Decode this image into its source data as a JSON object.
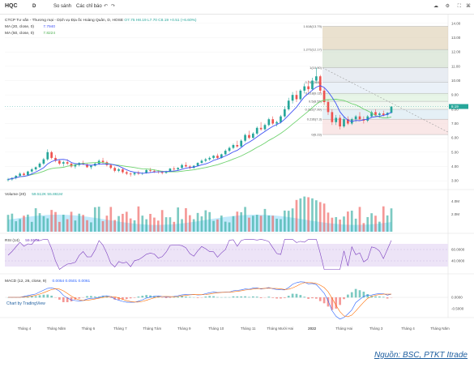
{
  "toolbar": {
    "symbol": "HQC",
    "interval": "D",
    "compare": "So sánh",
    "indicators": "Các chỉ báo",
    "undo": "↶",
    "redo": "↷"
  },
  "legend": {
    "main": "CTCP Tư vấn - Thương mại - Dịch vụ Địa ốc Hoàng Quân, D, HOSE",
    "ohlc": "O7.75  H8.19  L7.70  C8.19  +0.51 (+6.60%)",
    "ma20_label": "MA (20, close, 0)",
    "ma20_value": "7.7940",
    "ma50_label": "MA (50, close, 0)",
    "ma50_value": "7.8224",
    "volume_label": "Volume (20)",
    "volume_values": "59.512K  55.861M",
    "rsi_label": "RSI (14)",
    "rsi_value": "59.5503",
    "macd_label": "MACD (12, 26, close, 9)",
    "macd_values": "0.0054  0.0501  0.0061"
  },
  "badge": "Chart by TradingView",
  "source": "Nguồn: BSC, PTKT Itrade",
  "colors": {
    "up": "#26a69a",
    "down": "#ef5350",
    "ma20": "#3f51f5",
    "ma50": "#6fd26f",
    "rsi": "#7b3fbf",
    "macd": "#2962ff",
    "signal": "#ff6d00"
  },
  "chart_data": {
    "type": "candlestick",
    "x_labels": [
      "Tháng 4",
      "Tháng Năm",
      "Tháng 6",
      "Tháng 7",
      "Tháng Tám",
      "Tháng 9",
      "Tháng 10",
      "Tháng 11",
      "Tháng Mười Hai",
      "2022",
      "Tháng Hai",
      "Tháng 3",
      "Tháng 4",
      "Tháng Năm"
    ],
    "y_ticks": [
      3.0,
      4.0,
      5.0,
      6.0,
      7.0,
      8.0,
      9.0,
      10.0,
      11.0,
      12.0,
      13.0,
      14.0
    ],
    "price_range": [
      2.5,
      14.5
    ],
    "last_price": 8.19,
    "fibonacci": [
      {
        "label": "1.618(13.79)",
        "value": 13.79
      },
      {
        "label": "1.272(12.17)",
        "value": 12.17
      },
      {
        "label": "1(10.90)",
        "value": 10.9
      },
      {
        "label": "0.786(9.88)",
        "value": 9.88
      },
      {
        "label": "0.618(9.11)",
        "value": 9.11
      },
      {
        "label": "0.5(8.55)",
        "value": 8.55
      },
      {
        "label": "0.382(7.99)",
        "value": 7.99
      },
      {
        "label": "0.236(7.3)",
        "value": 7.3
      },
      {
        "label": "0(6.23)",
        "value": 6.23
      }
    ],
    "candles": [
      [
        3.05,
        3.2,
        2.95,
        3.1
      ],
      [
        3.1,
        3.25,
        3.0,
        3.2
      ],
      [
        3.2,
        3.4,
        3.1,
        3.35
      ],
      [
        3.35,
        3.6,
        3.25,
        3.5
      ],
      [
        3.5,
        3.6,
        3.3,
        3.4
      ],
      [
        3.4,
        3.7,
        3.35,
        3.65
      ],
      [
        3.65,
        3.9,
        3.55,
        3.8
      ],
      [
        3.8,
        4.0,
        3.7,
        3.95
      ],
      [
        3.95,
        4.3,
        3.9,
        4.2
      ],
      [
        4.2,
        4.6,
        4.1,
        4.5
      ],
      [
        4.5,
        5.2,
        4.4,
        5.0
      ],
      [
        5.0,
        5.1,
        4.5,
        4.6
      ],
      [
        4.6,
        4.8,
        4.3,
        4.4
      ],
      [
        4.4,
        4.5,
        4.1,
        4.2
      ],
      [
        4.2,
        4.4,
        4.0,
        4.3
      ],
      [
        4.3,
        4.5,
        4.1,
        4.2
      ],
      [
        4.2,
        4.3,
        3.9,
        4.0
      ],
      [
        4.0,
        4.2,
        3.85,
        4.1
      ],
      [
        4.1,
        4.3,
        4.0,
        4.25
      ],
      [
        4.25,
        4.4,
        4.1,
        4.15
      ],
      [
        4.15,
        4.2,
        3.9,
        3.95
      ],
      [
        3.95,
        4.1,
        3.8,
        4.05
      ],
      [
        4.05,
        4.3,
        4.0,
        4.2
      ],
      [
        4.2,
        4.5,
        4.1,
        4.4
      ],
      [
        4.4,
        4.6,
        4.2,
        4.3
      ],
      [
        4.3,
        4.4,
        4.0,
        4.1
      ],
      [
        4.1,
        4.2,
        3.8,
        3.9
      ],
      [
        3.9,
        4.0,
        3.6,
        3.7
      ],
      [
        3.7,
        3.9,
        3.6,
        3.8
      ],
      [
        3.8,
        3.9,
        3.5,
        3.6
      ],
      [
        3.6,
        3.7,
        3.4,
        3.5
      ],
      [
        3.5,
        3.6,
        3.3,
        3.45
      ],
      [
        3.45,
        3.6,
        3.35,
        3.55
      ],
      [
        3.55,
        3.7,
        3.4,
        3.5
      ],
      [
        3.5,
        3.6,
        3.4,
        3.55
      ],
      [
        3.55,
        3.8,
        3.5,
        3.75
      ],
      [
        3.75,
        3.9,
        3.6,
        3.7
      ],
      [
        3.7,
        3.8,
        3.55,
        3.65
      ],
      [
        3.65,
        3.75,
        3.5,
        3.6
      ],
      [
        3.6,
        3.7,
        3.45,
        3.55
      ],
      [
        3.55,
        3.7,
        3.5,
        3.65
      ],
      [
        3.65,
        3.9,
        3.6,
        3.85
      ],
      [
        3.85,
        4.0,
        3.7,
        3.8
      ],
      [
        3.8,
        3.95,
        3.7,
        3.9
      ],
      [
        3.9,
        4.2,
        3.85,
        4.1
      ],
      [
        4.1,
        4.3,
        3.95,
        4.0
      ],
      [
        4.0,
        4.1,
        3.8,
        3.9
      ],
      [
        3.9,
        4.1,
        3.85,
        4.05
      ],
      [
        4.05,
        4.3,
        4.0,
        4.25
      ],
      [
        4.25,
        4.5,
        4.2,
        4.4
      ],
      [
        4.4,
        4.6,
        4.3,
        4.5
      ],
      [
        4.5,
        4.7,
        4.4,
        4.6
      ],
      [
        4.6,
        4.8,
        4.5,
        4.75
      ],
      [
        4.75,
        4.9,
        4.5,
        4.6
      ],
      [
        4.6,
        4.9,
        4.55,
        4.85
      ],
      [
        4.85,
        5.2,
        4.8,
        5.1
      ],
      [
        5.1,
        5.4,
        5.0,
        5.3
      ],
      [
        5.3,
        5.6,
        5.2,
        5.5
      ],
      [
        5.5,
        5.8,
        5.3,
        5.4
      ],
      [
        5.4,
        5.9,
        5.35,
        5.8
      ],
      [
        5.8,
        6.3,
        5.7,
        6.2
      ],
      [
        6.2,
        6.5,
        5.9,
        6.0
      ],
      [
        6.0,
        6.4,
        5.95,
        6.3
      ],
      [
        6.3,
        6.8,
        6.2,
        6.7
      ],
      [
        6.7,
        7.1,
        6.5,
        6.6
      ],
      [
        6.6,
        7.0,
        6.5,
        6.9
      ],
      [
        6.9,
        7.4,
        6.8,
        7.3
      ],
      [
        7.3,
        7.5,
        6.9,
        7.0
      ],
      [
        7.0,
        7.2,
        6.8,
        7.1
      ],
      [
        7.1,
        7.6,
        7.0,
        7.5
      ],
      [
        7.5,
        8.2,
        7.4,
        8.0
      ],
      [
        8.0,
        8.8,
        7.9,
        8.6
      ],
      [
        8.6,
        9.2,
        8.4,
        9.0
      ],
      [
        9.0,
        9.3,
        8.5,
        8.7
      ],
      [
        8.7,
        9.4,
        8.6,
        9.3
      ],
      [
        9.3,
        9.8,
        9.1,
        9.6
      ],
      [
        9.6,
        10.0,
        9.2,
        9.4
      ],
      [
        9.4,
        10.2,
        9.3,
        10.0
      ],
      [
        10.0,
        10.9,
        9.8,
        10.3
      ],
      [
        10.3,
        10.4,
        9.1,
        9.3
      ],
      [
        9.3,
        9.5,
        8.3,
        8.5
      ],
      [
        8.5,
        8.7,
        7.6,
        7.8
      ],
      [
        7.8,
        8.0,
        6.9,
        7.1
      ],
      [
        7.1,
        7.6,
        6.9,
        7.4
      ],
      [
        7.4,
        7.6,
        6.6,
        6.8
      ],
      [
        6.8,
        7.5,
        6.7,
        7.3
      ],
      [
        7.3,
        7.5,
        6.9,
        7.0
      ],
      [
        7.0,
        7.4,
        6.9,
        7.3
      ],
      [
        7.3,
        7.6,
        7.1,
        7.5
      ],
      [
        7.5,
        7.8,
        7.2,
        7.3
      ],
      [
        7.3,
        7.5,
        7.0,
        7.2
      ],
      [
        7.2,
        7.6,
        7.1,
        7.5
      ],
      [
        7.5,
        7.9,
        7.4,
        7.8
      ],
      [
        7.8,
        8.0,
        7.5,
        7.6
      ],
      [
        7.6,
        7.8,
        7.4,
        7.7
      ],
      [
        7.7,
        7.9,
        7.5,
        7.6
      ],
      [
        7.6,
        7.8,
        7.4,
        7.75
      ],
      [
        7.75,
        8.19,
        7.7,
        8.19
      ]
    ],
    "panes": [
      "Price",
      "Volume",
      "RSI",
      "MACD"
    ],
    "rsi_ticks": [
      60.0,
      40.0
    ],
    "macd_ticks": [
      0.0,
      -0.5
    ],
    "volume_ticks": [
      "4.0M",
      "2.0M"
    ]
  }
}
